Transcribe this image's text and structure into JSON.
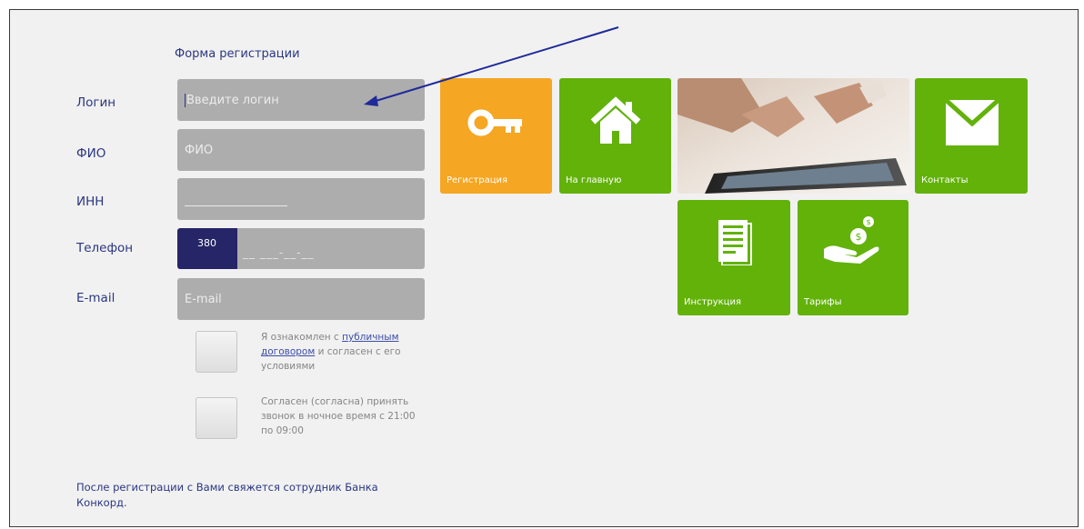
{
  "form": {
    "title": "Форма регистрации",
    "login": {
      "label": "Логин",
      "placeholder": "Введите логин"
    },
    "fio": {
      "label": "ФИО",
      "placeholder": "ФИО"
    },
    "inn": {
      "label": "ИНН"
    },
    "phone": {
      "label": "Телефон",
      "code": "380",
      "mask": "__ ___-__-__"
    },
    "email": {
      "label": "E-mail",
      "placeholder": "E-mail"
    },
    "agreement": {
      "text_before": "Я ознакомлен с ",
      "link": "публичным договором",
      "text_after": " и согласен с его условиями"
    },
    "night_call": "Согласен (согласна) принять звонок в ночное время с 21:00 по 09:00",
    "footer_note": "После регистрации с Вами свяжется сотрудник Банка Конкорд."
  },
  "tiles": {
    "registration": {
      "label": "Регистрация",
      "icon": "key-icon",
      "color": "#f5a623"
    },
    "home": {
      "label": "На главную",
      "icon": "home-icon",
      "color": "#62b20a"
    },
    "contacts": {
      "label": "Контакты",
      "icon": "envelope-icon",
      "color": "#62b20a"
    },
    "instruction": {
      "label": "Инструкция",
      "icon": "document-icon",
      "color": "#62b20a"
    },
    "tariffs": {
      "label": "Тарифы",
      "icon": "money-hand-icon",
      "color": "#62b20a"
    }
  },
  "colors": {
    "label_text": "#2a3680",
    "field_bg": "#adadad",
    "phone_code_bg": "#252567",
    "tile_green": "#62b20a",
    "tile_orange": "#f5a623",
    "annotation_arrow": "#1f2a9a"
  }
}
